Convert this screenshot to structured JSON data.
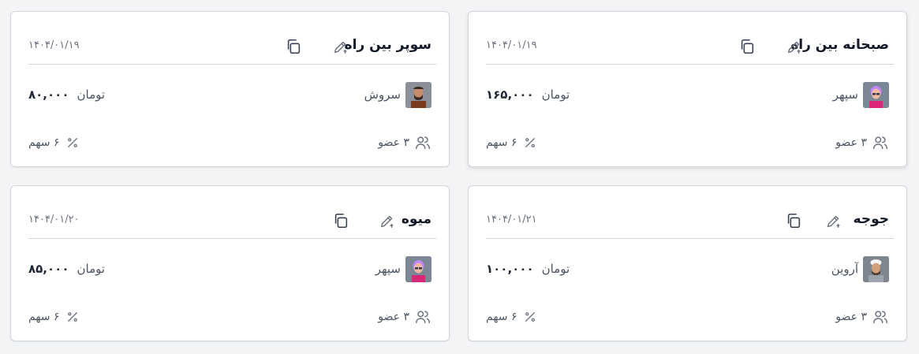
{
  "expenses": [
    {
      "title": "صبحانه بین راه",
      "date": "۱۴۰۴/۰۱/۱۹",
      "payer": "سپهر",
      "avatar": "avatar-sepehr",
      "amount": "۱۶۵,۰۰۰",
      "currency": "تومان",
      "members": "۳ عضو",
      "share": "۶ سهم"
    },
    {
      "title": "سوپر بین راه",
      "date": "۱۴۰۴/۰۱/۱۹",
      "payer": "سروش",
      "avatar": "avatar-soroush",
      "amount": "۸۰,۰۰۰",
      "currency": "تومان",
      "members": "۳ عضو",
      "share": "۶ سهم"
    },
    {
      "title": "جوجه",
      "date": "۱۴۰۴/۰۱/۲۱",
      "payer": "آروین",
      "avatar": "avatar-arvin",
      "amount": "۱۰۰,۰۰۰",
      "currency": "تومان",
      "members": "۳ عضو",
      "share": "۶ سهم"
    },
    {
      "title": "میوه",
      "date": "۱۴۰۴/۰۱/۲۰",
      "payer": "سپهر",
      "avatar": "avatar-sepehr",
      "amount": "۸۵,۰۰۰",
      "currency": "تومان",
      "members": "۳ عضو",
      "share": "۶ سهم"
    }
  ],
  "icons": {
    "copy": "copy-icon",
    "edit": "edit-pen-icon",
    "members": "users-icon",
    "share": "percent-icon"
  },
  "colors": {
    "background": "#f3f4f6",
    "card": "#ffffff",
    "border": "#d1d5db",
    "text_primary": "#111827",
    "text_secondary": "#6b7280"
  }
}
